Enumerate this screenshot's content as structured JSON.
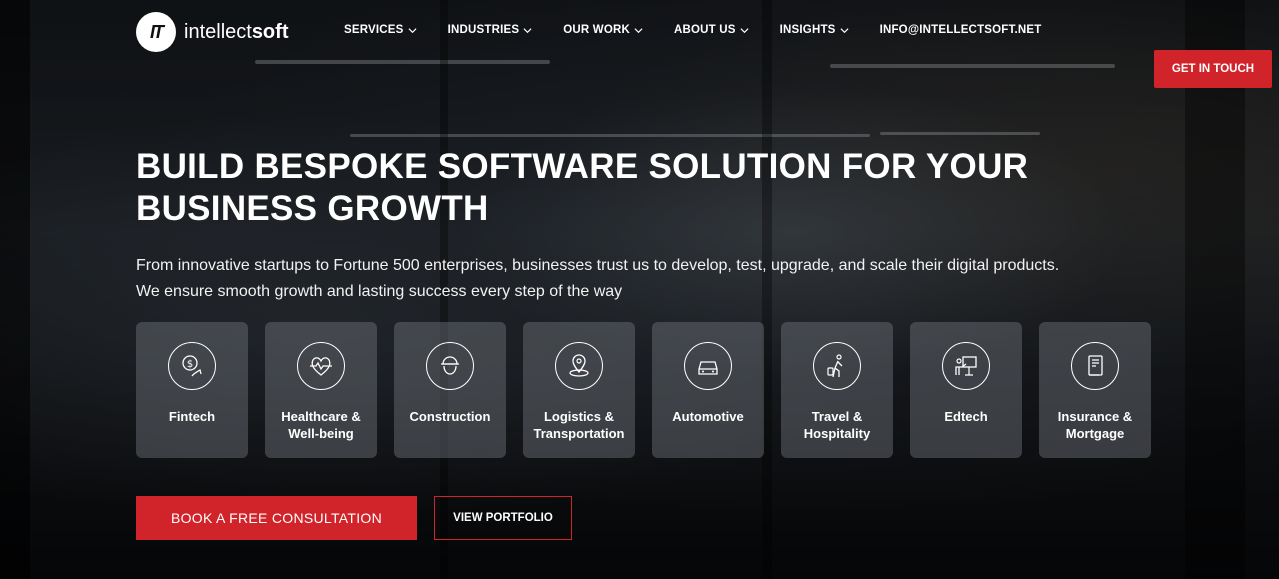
{
  "brand": {
    "logo_mark": "IT",
    "name_regular": "intellect",
    "name_bold": "soft"
  },
  "nav": {
    "items": [
      {
        "label": "SERVICES",
        "dropdown": true
      },
      {
        "label": "INDUSTRIES",
        "dropdown": true
      },
      {
        "label": "OUR WORK",
        "dropdown": true
      },
      {
        "label": "ABOUT US",
        "dropdown": true
      },
      {
        "label": "INSIGHTS",
        "dropdown": true
      },
      {
        "label": "INFO@INTELLECTSOFT.NET",
        "dropdown": false
      }
    ],
    "cta_label": "GET IN TOUCH"
  },
  "hero": {
    "title_line1": "BUILD BESPOKE SOFTWARE SOLUTION FOR YOUR",
    "title_line2": "BUSINESS GROWTH",
    "subtitle_line1": "From innovative startups to Fortune 500 enterprises, businesses trust us to develop, test, upgrade, and scale their digital products.",
    "subtitle_line2": "We ensure smooth growth and lasting success every step of the way"
  },
  "industries": [
    {
      "label": "Fintech",
      "icon": "fintech-icon"
    },
    {
      "label": "Healthcare &\nWell-being",
      "icon": "healthcare-icon"
    },
    {
      "label": "Construction",
      "icon": "construction-icon"
    },
    {
      "label": "Logistics &\nTransportation",
      "icon": "logistics-icon"
    },
    {
      "label": "Automotive",
      "icon": "automotive-icon"
    },
    {
      "label": "Travel &\nHospitality",
      "icon": "travel-icon"
    },
    {
      "label": "Edtech",
      "icon": "edtech-icon"
    },
    {
      "label": "Insurance &\nMortgage",
      "icon": "insurance-icon"
    }
  ],
  "actions": {
    "primary_label": "BOOK A FREE CONSULTATION",
    "secondary_label": "VIEW PORTFOLIO"
  },
  "colors": {
    "accent": "#d1242a",
    "card_bg": "rgba(120,125,130,0.42)"
  }
}
